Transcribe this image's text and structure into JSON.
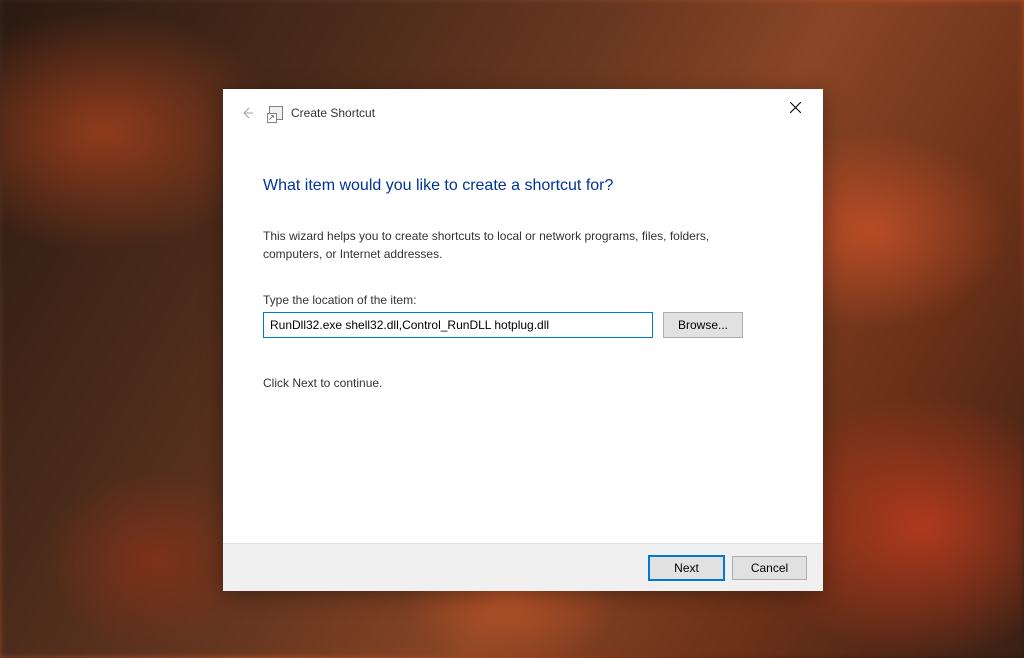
{
  "dialog": {
    "title": "Create Shortcut",
    "heading": "What item would you like to create a shortcut for?",
    "description": "This wizard helps you to create shortcuts to local or network programs, files, folders, computers, or Internet addresses.",
    "field_label": "Type the location of the item:",
    "location_value": "RunDll32.exe shell32.dll,Control_RunDLL hotplug.dll",
    "browse_label": "Browse...",
    "instruction": "Click Next to continue.",
    "next_label": "Next",
    "cancel_label": "Cancel"
  }
}
